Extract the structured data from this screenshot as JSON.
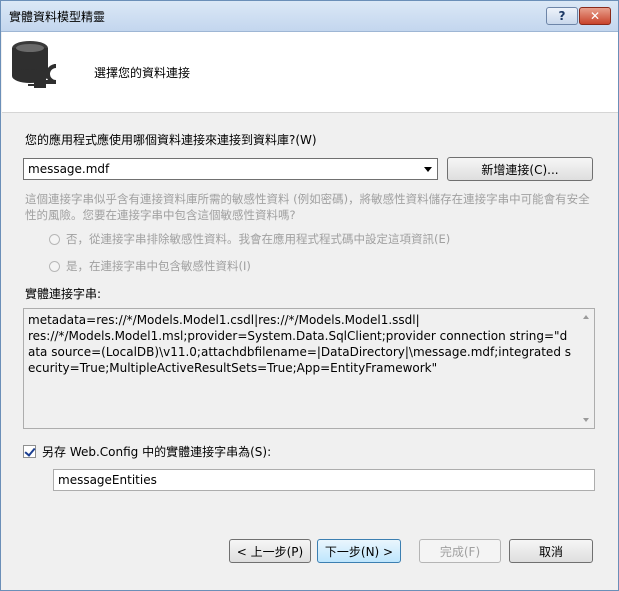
{
  "window": {
    "title": "實體資料模型精靈",
    "help_label": "?",
    "close_label": "✕"
  },
  "header": {
    "text": "選擇您的資料連接"
  },
  "connection": {
    "question": "您的應用程式應使用哪個資料連接來連接到資料庫?(W)",
    "selected": "message.mdf",
    "new_button": "新增連接(C)..."
  },
  "sensitive": {
    "note": "這個連接字串似乎含有連接資料庫所需的敏感性資料 (例如密碼)，將敏感性資料儲存在連接字串中可能會有安全性的風險。您要在連接字串中包含這個敏感性資料嗎?",
    "option_exclude": "否，從連接字串排除敏感性資料。我會在應用程式程式碼中設定這項資訊(E)",
    "option_include": "是，在連接字串中包含敏感性資料(I)"
  },
  "entity_connection": {
    "label": "實體連接字串:",
    "value": "metadata=res://*/Models.Model1.csdl|res://*/Models.Model1.ssdl|\nres://*/Models.Model1.msl;provider=System.Data.SqlClient;provider connection string=\"data source=(LocalDB)\\v11.0;attachdbfilename=|DataDirectory|\\message.mdf;integrated security=True;MultipleActiveResultSets=True;App=EntityFramework\""
  },
  "save_config": {
    "checked": true,
    "label": "另存 Web.Config 中的實體連接字串為(S):",
    "value": "messageEntities"
  },
  "footer": {
    "prev": "< 上一步(P)",
    "next": "下一步(N) >",
    "finish": "完成(F)",
    "cancel": "取消"
  }
}
